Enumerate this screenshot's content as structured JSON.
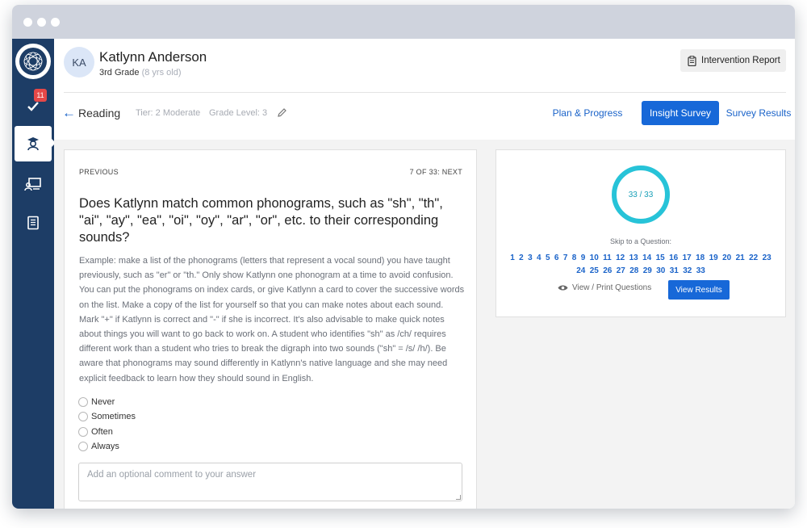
{
  "student": {
    "initials": "KA",
    "name": "Katlynn Anderson",
    "grade": "3rd Grade",
    "age": "(8 yrs old)"
  },
  "sidebar": {
    "badge_count": "11",
    "items": [
      {
        "icon": "checkmark-icon"
      },
      {
        "icon": "student-icon"
      },
      {
        "icon": "teacher-screen-icon"
      },
      {
        "icon": "book-icon"
      }
    ]
  },
  "header": {
    "report_label": "Intervention Report",
    "subject": "Reading",
    "tier": "Tier: 2 Moderate",
    "grade_level": "Grade Level: 3",
    "tabs": [
      {
        "label": "Plan & Progress",
        "active": false
      },
      {
        "label": "Insight Survey",
        "active": true
      },
      {
        "label": "Survey Results",
        "active": false
      }
    ]
  },
  "question": {
    "previous_label": "PREVIOUS",
    "position_label": "7 OF 33: NEXT",
    "text": "Does Katlynn match common phonograms, such as \"sh\", \"th\", \"ai\", \"ay\", \"ea\", \"oi\", \"oy\", \"ar\", \"or\", etc. to their corresponding sounds?",
    "example": "Example: make a list of the phonograms (letters that represent a vocal sound) you have taught previously, such as \"er\" or \"th.\" Only show Katlynn one phonogram at a time to avoid confusion. You can put the phonograms on index cards, or give Katlynn a card to cover the successive words on the list. Make a copy of the list for yourself so that you can make notes about each sound. Mark \"+\" if Katlynn is correct and \"-\" if she is incorrect. It's also advisable to make quick notes about things you will want to go back to work on. A student who identifies \"sh\" as /ch/ requires different work than a student who tries to break the digraph into two sounds (\"sh\" = /s/ /h/). Be aware that phonograms may sound differently in Katlynn's native language and she may need explicit feedback to learn how they should sound in English.",
    "options": [
      "Never",
      "Sometimes",
      "Often",
      "Always"
    ],
    "comment_placeholder": "Add an optional comment to your answer"
  },
  "progress": {
    "label": "33 / 33",
    "completed": 33,
    "total": 33,
    "ring_color": "#27c3d8",
    "skip_label": "Skip to a Question:",
    "questions": [
      "1",
      "2",
      "3",
      "4",
      "5",
      "6",
      "7",
      "8",
      "9",
      "10",
      "11",
      "12",
      "13",
      "14",
      "15",
      "16",
      "17",
      "18",
      "19",
      "20",
      "21",
      "22",
      "23",
      "24",
      "25",
      "26",
      "27",
      "28",
      "29",
      "30",
      "31",
      "32",
      "33"
    ],
    "view_print_label": "View / Print Questions",
    "view_results_label": "View Results"
  },
  "colors": {
    "sidebar": "#1d3d66",
    "accent": "#1768d8",
    "badge": "#e54848"
  }
}
